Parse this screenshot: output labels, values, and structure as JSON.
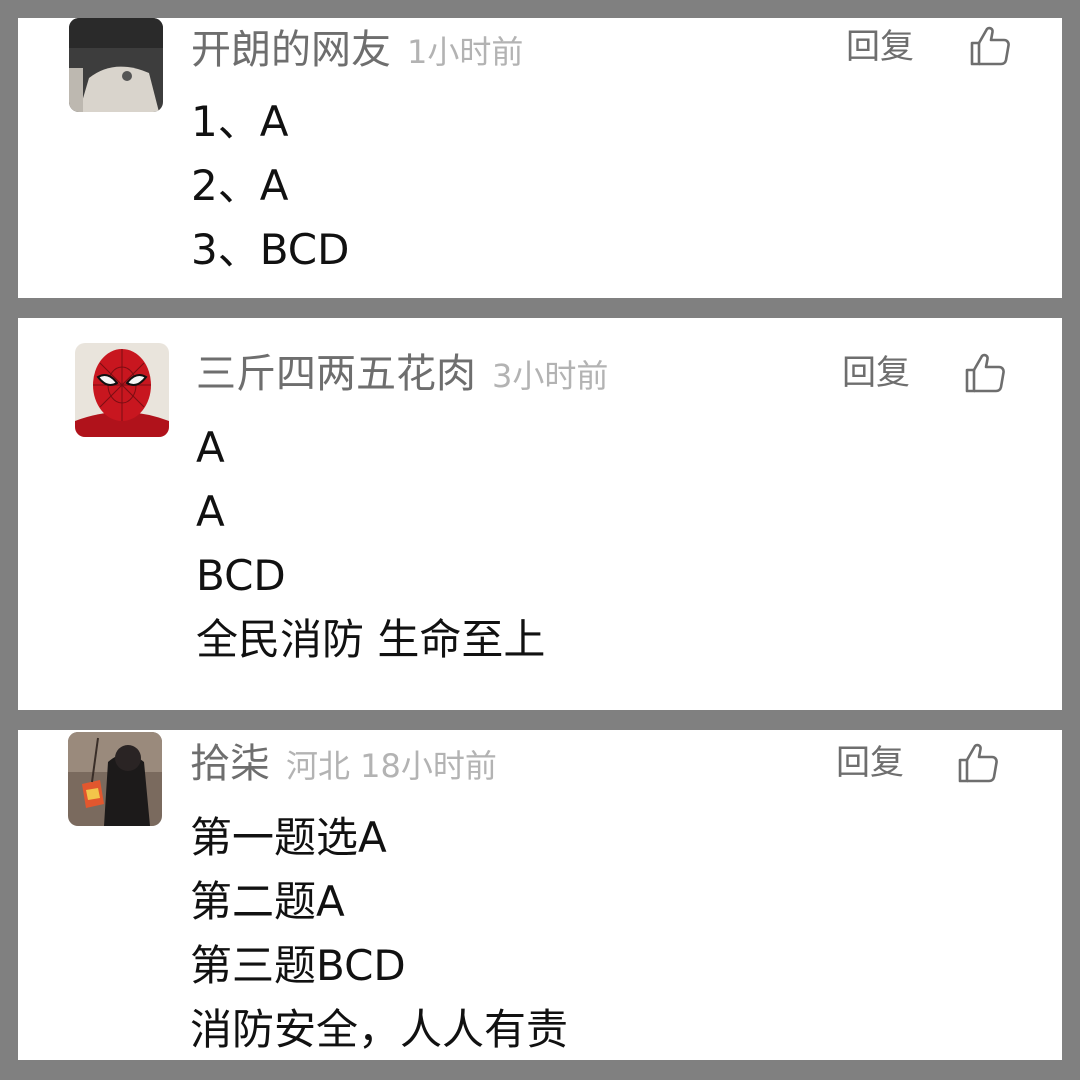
{
  "comments": [
    {
      "username": "开朗的网友",
      "meta": "1小时前",
      "reply_label": "回复",
      "like_icon": "thumbs-up-icon",
      "avatar_icon": "avatar-dark-photo",
      "lines": [
        "1、A",
        "2、A",
        "3、BCD"
      ]
    },
    {
      "username": "三斤四两五花肉",
      "meta": "3小时前",
      "reply_label": "回复",
      "like_icon": "thumbs-up-icon",
      "avatar_icon": "avatar-spider-mask",
      "lines": [
        "A",
        "A",
        "BCD",
        "全民消防 生命至上"
      ]
    },
    {
      "username": "拾柒",
      "meta": "河北 18小时前",
      "reply_label": "回复",
      "like_icon": "thumbs-up-icon",
      "avatar_icon": "avatar-person-photo",
      "lines": [
        "第一题选A",
        "第二题A",
        "第三题BCD",
        "消防安全，人人有责"
      ]
    }
  ],
  "colors": {
    "background": "#808080",
    "card": "#ffffff",
    "username": "#6e6e6e",
    "meta": "#b3b3b3",
    "body_text": "#111111"
  }
}
